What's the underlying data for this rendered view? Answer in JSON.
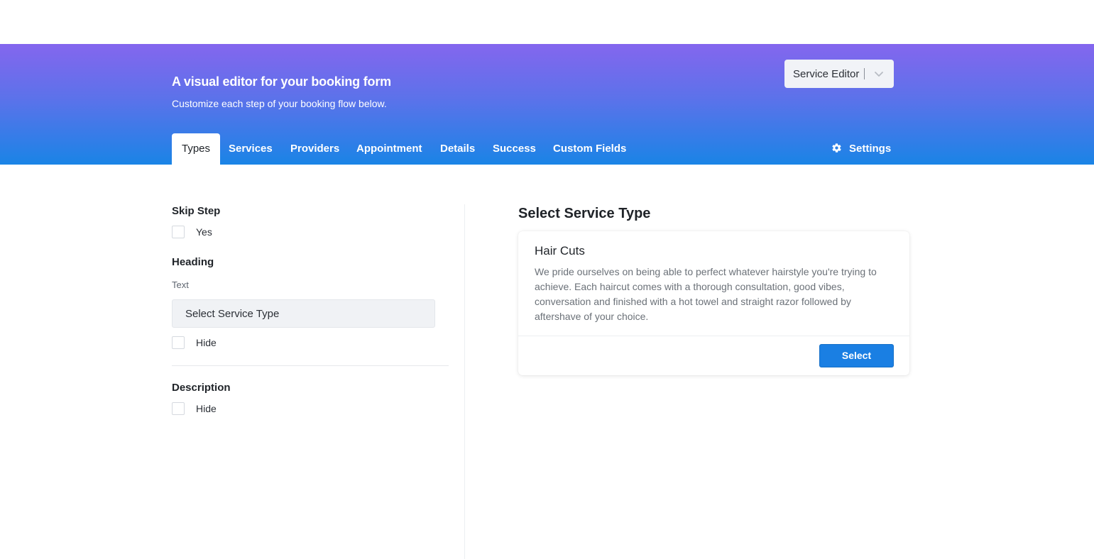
{
  "header": {
    "title": "A visual editor for your booking form",
    "subtitle": "Customize each step of your booking flow below.",
    "editor_select": {
      "value": "Service Editor",
      "icon": "chevron-down-icon"
    },
    "tabs": [
      {
        "label": "Types",
        "active": true
      },
      {
        "label": "Services",
        "active": false
      },
      {
        "label": "Providers",
        "active": false
      },
      {
        "label": "Appointment",
        "active": false
      },
      {
        "label": "Details",
        "active": false
      },
      {
        "label": "Success",
        "active": false
      },
      {
        "label": "Custom Fields",
        "active": false
      }
    ],
    "settings": {
      "label": "Settings",
      "icon": "gear-icon"
    }
  },
  "sidebar": {
    "skip_step": {
      "heading": "Skip Step",
      "option_label": "Yes",
      "checked": false
    },
    "heading_section": {
      "heading": "Heading",
      "text_label": "Text",
      "text_value": "Select Service Type",
      "hide_label": "Hide",
      "hide_checked": false
    },
    "description_section": {
      "heading": "Description",
      "hide_label": "Hide",
      "hide_checked": false
    }
  },
  "preview": {
    "heading": "Select Service Type",
    "card": {
      "title": "Hair Cuts",
      "description": "We pride ourselves on being able to perfect whatever hairstyle you're trying to achieve. Each haircut comes with a thorough consultation, good vibes, conversation and finished with a hot towel and straight razor followed by aftershave of your choice.",
      "button_label": "Select"
    }
  },
  "colors": {
    "banner_top": "#8466ee",
    "banner_bottom": "#1a84e6",
    "primary_button": "#1a7fe3"
  }
}
